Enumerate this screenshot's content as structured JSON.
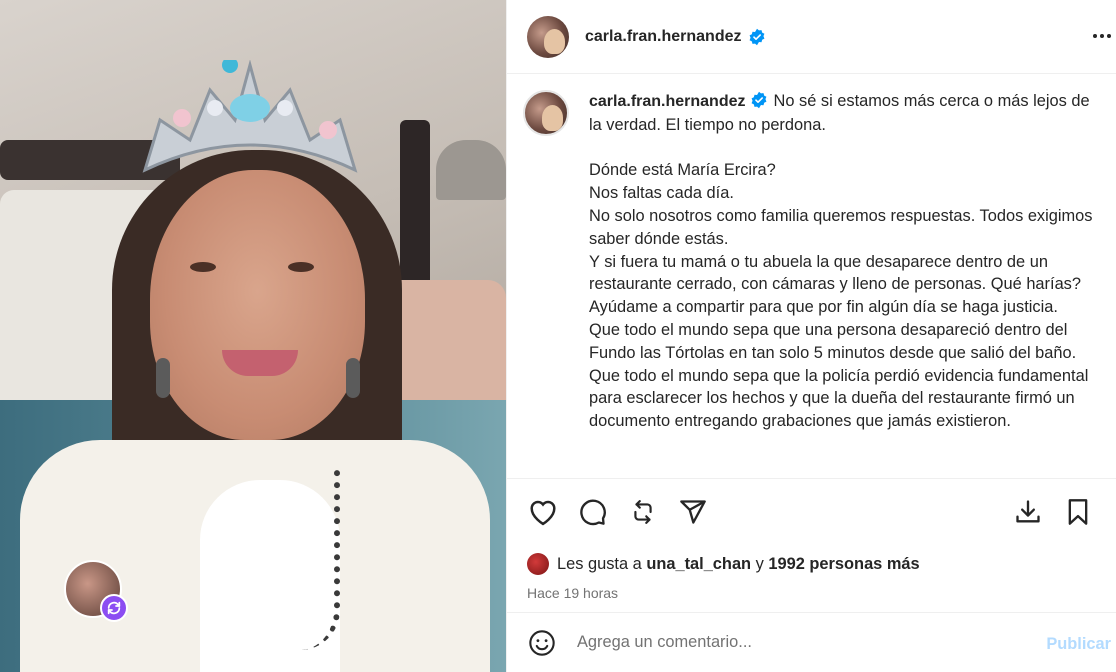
{
  "post": {
    "author": "carla.fran.hernandez",
    "verified": true,
    "caption": "No sé si estamos más cerca o más lejos de la verdad. El tiempo no perdona.\n\nDónde está María Ercira?\nNos faltas cada día.\nNo solo nosotros como familia queremos respuestas. Todos exigimos saber dónde estás.\nY si fuera tu mamá o tu abuela la que desaparece dentro de un restaurante cerrado, con cámaras y lleno de personas. Qué harías?\nAyúdame a compartir para que por fin algún día se haga justicia.\nQue todo el mundo sepa que una persona desapareció dentro del Fundo las Tórtolas en tan solo 5 minutos desde que salió del baño. Que todo el mundo sepa que la policía perdió evidencia fundamental para esclarecer los hechos y que la dueña del restaurante firmó un documento entregando grabaciones que jamás existieron."
  },
  "likes": {
    "prefix": "Les gusta a",
    "user": "una_tal_chan",
    "connector": "y",
    "count_text": "1992 personas más"
  },
  "timestamp": "Hace 19 horas",
  "comment": {
    "placeholder": "Agrega un comentario...",
    "publish_label": "Publicar"
  },
  "icons": {
    "more": "more-horizontal-icon",
    "like": "heart-icon",
    "comment": "comment-bubble-icon",
    "repost": "repost-icon",
    "share": "send-icon",
    "download": "download-icon",
    "save": "bookmark-icon",
    "emoji": "emoji-icon",
    "collab": "sync-icon"
  },
  "colors": {
    "verified": "#0095f6",
    "publish_disabled": "#b3dbff",
    "collab_badge": "#8c4df2",
    "text": "#262626",
    "secondary_text": "#737373"
  }
}
